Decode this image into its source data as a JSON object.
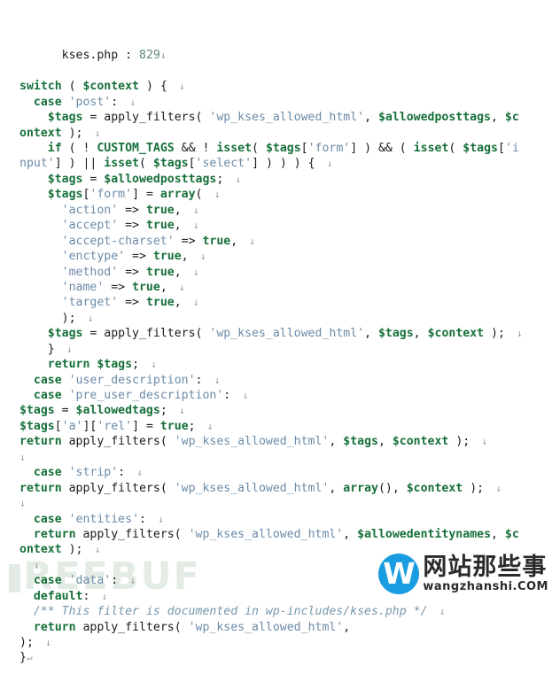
{
  "header": {
    "file_name": "kses.php",
    "separator": ":",
    "line_number": "829",
    "eol": "↓"
  },
  "watermarks": {
    "left": {
      "text": "REEBUF",
      "full_text": "FREEBUF",
      "color": "#e3ece4"
    },
    "right": {
      "logo_letter": "W",
      "logo_color": "#1a9de0",
      "title_cn": "网站那些事",
      "title_en": "wangzhanshi.COM",
      "text_color": "#2a2a2a"
    }
  },
  "colors": {
    "background": "#ffffff",
    "keyword": "#17703a",
    "variable": "#17703a",
    "string": "#6b8ba8",
    "punctuation": "#1b1b1b",
    "comment": "#7697ad",
    "eol_marker": "#9a9a9a",
    "line_number": "#5f8a74"
  },
  "eol_marker": "↓",
  "code_lines": [
    {
      "indent": 0,
      "wrapped": false,
      "tokens": [
        {
          "t": "kw",
          "v": "switch"
        },
        {
          "t": "pun",
          "v": " ( "
        },
        {
          "t": "var",
          "v": "$context"
        },
        {
          "t": "pun",
          "v": " ) {"
        },
        {
          "t": "eol",
          "v": "  ↓"
        }
      ]
    },
    {
      "indent": 1,
      "wrapped": false,
      "tokens": [
        {
          "t": "kw",
          "v": "case"
        },
        {
          "t": "pun",
          "v": " "
        },
        {
          "t": "str",
          "v": "'post'"
        },
        {
          "t": "pun",
          "v": ":"
        },
        {
          "t": "eol",
          "v": "  ↓"
        }
      ]
    },
    {
      "indent": 2,
      "wrapped": false,
      "tokens": [
        {
          "t": "var",
          "v": "$tags"
        },
        {
          "t": "pun",
          "v": " = "
        },
        {
          "t": "fn",
          "v": "apply_filters"
        },
        {
          "t": "pun",
          "v": "( "
        },
        {
          "t": "str",
          "v": "'wp_kses_allowed_html'"
        },
        {
          "t": "pun",
          "v": ", "
        },
        {
          "t": "var",
          "v": "$allowedposttags"
        },
        {
          "t": "pun",
          "v": ", "
        },
        {
          "t": "var",
          "v": "$c"
        }
      ]
    },
    {
      "indent": 0,
      "wrapped": true,
      "tokens": [
        {
          "t": "var",
          "v": "ontext"
        },
        {
          "t": "pun",
          "v": " );"
        },
        {
          "t": "eol",
          "v": "  ↓"
        }
      ]
    },
    {
      "indent": 2,
      "wrapped": false,
      "tokens": [
        {
          "t": "kw",
          "v": "if"
        },
        {
          "t": "pun",
          "v": " ( ! "
        },
        {
          "t": "var",
          "v": "CUSTOM_TAGS"
        },
        {
          "t": "pun",
          "v": " && ! "
        },
        {
          "t": "var",
          "v": "isset"
        },
        {
          "t": "pun",
          "v": "( "
        },
        {
          "t": "var",
          "v": "$tags"
        },
        {
          "t": "pun",
          "v": "["
        },
        {
          "t": "str",
          "v": "'form'"
        },
        {
          "t": "pun",
          "v": "] ) && ( "
        },
        {
          "t": "var",
          "v": "isset"
        },
        {
          "t": "pun",
          "v": "( "
        },
        {
          "t": "var",
          "v": "$tags"
        },
        {
          "t": "pun",
          "v": "["
        },
        {
          "t": "str",
          "v": "'i"
        }
      ]
    },
    {
      "indent": 0,
      "wrapped": true,
      "tokens": [
        {
          "t": "str",
          "v": "nput'"
        },
        {
          "t": "pun",
          "v": "] ) || "
        },
        {
          "t": "var",
          "v": "isset"
        },
        {
          "t": "pun",
          "v": "( "
        },
        {
          "t": "var",
          "v": "$tags"
        },
        {
          "t": "pun",
          "v": "["
        },
        {
          "t": "str",
          "v": "'select'"
        },
        {
          "t": "pun",
          "v": "] ) ) ) {"
        },
        {
          "t": "eol",
          "v": "  ↓"
        }
      ]
    },
    {
      "indent": 2,
      "wrapped": false,
      "tokens": [
        {
          "t": "var",
          "v": "$tags"
        },
        {
          "t": "pun",
          "v": " = "
        },
        {
          "t": "var",
          "v": "$allowedposttags"
        },
        {
          "t": "pun",
          "v": ";"
        },
        {
          "t": "eol",
          "v": "  ↓"
        }
      ]
    },
    {
      "indent": 2,
      "wrapped": false,
      "tokens": [
        {
          "t": "var",
          "v": "$tags"
        },
        {
          "t": "pun",
          "v": "["
        },
        {
          "t": "str",
          "v": "'form'"
        },
        {
          "t": "pun",
          "v": "] = "
        },
        {
          "t": "var",
          "v": "array"
        },
        {
          "t": "pun",
          "v": "("
        },
        {
          "t": "eol",
          "v": "  ↓"
        }
      ]
    },
    {
      "indent": 3,
      "wrapped": false,
      "tokens": [
        {
          "t": "str",
          "v": "'action'"
        },
        {
          "t": "pun",
          "v": " => "
        },
        {
          "t": "var",
          "v": "true"
        },
        {
          "t": "pun",
          "v": ","
        },
        {
          "t": "eol",
          "v": "  ↓"
        }
      ]
    },
    {
      "indent": 3,
      "wrapped": false,
      "tokens": [
        {
          "t": "str",
          "v": "'accept'"
        },
        {
          "t": "pun",
          "v": " => "
        },
        {
          "t": "var",
          "v": "true"
        },
        {
          "t": "pun",
          "v": ","
        },
        {
          "t": "eol",
          "v": "  ↓"
        }
      ]
    },
    {
      "indent": 3,
      "wrapped": false,
      "tokens": [
        {
          "t": "str",
          "v": "'accept-charset'"
        },
        {
          "t": "pun",
          "v": " => "
        },
        {
          "t": "var",
          "v": "true"
        },
        {
          "t": "pun",
          "v": ","
        },
        {
          "t": "eol",
          "v": "  ↓"
        }
      ]
    },
    {
      "indent": 3,
      "wrapped": false,
      "tokens": [
        {
          "t": "str",
          "v": "'enctype'"
        },
        {
          "t": "pun",
          "v": " => "
        },
        {
          "t": "var",
          "v": "true"
        },
        {
          "t": "pun",
          "v": ","
        },
        {
          "t": "eol",
          "v": "  ↓"
        }
      ]
    },
    {
      "indent": 3,
      "wrapped": false,
      "tokens": [
        {
          "t": "str",
          "v": "'method'"
        },
        {
          "t": "pun",
          "v": " => "
        },
        {
          "t": "var",
          "v": "true"
        },
        {
          "t": "pun",
          "v": ","
        },
        {
          "t": "eol",
          "v": "  ↓"
        }
      ]
    },
    {
      "indent": 3,
      "wrapped": false,
      "tokens": [
        {
          "t": "str",
          "v": "'name'"
        },
        {
          "t": "pun",
          "v": " => "
        },
        {
          "t": "var",
          "v": "true"
        },
        {
          "t": "pun",
          "v": ","
        },
        {
          "t": "eol",
          "v": "  ↓"
        }
      ]
    },
    {
      "indent": 3,
      "wrapped": false,
      "tokens": [
        {
          "t": "str",
          "v": "'target'"
        },
        {
          "t": "pun",
          "v": " => "
        },
        {
          "t": "var",
          "v": "true"
        },
        {
          "t": "pun",
          "v": ","
        },
        {
          "t": "eol",
          "v": "  ↓"
        }
      ]
    },
    {
      "indent": 3,
      "wrapped": false,
      "tokens": [
        {
          "t": "pun",
          "v": ");"
        },
        {
          "t": "eol",
          "v": "  ↓"
        }
      ]
    },
    {
      "indent": 2,
      "wrapped": false,
      "tokens": [
        {
          "t": "var",
          "v": "$tags"
        },
        {
          "t": "pun",
          "v": " = "
        },
        {
          "t": "fn",
          "v": "apply_filters"
        },
        {
          "t": "pun",
          "v": "( "
        },
        {
          "t": "str",
          "v": "'wp_kses_allowed_html'"
        },
        {
          "t": "pun",
          "v": ", "
        },
        {
          "t": "var",
          "v": "$tags"
        },
        {
          "t": "pun",
          "v": ", "
        },
        {
          "t": "var",
          "v": "$context"
        },
        {
          "t": "pun",
          "v": " );"
        },
        {
          "t": "eol",
          "v": "  ↓"
        }
      ]
    },
    {
      "indent": 2,
      "wrapped": false,
      "tokens": [
        {
          "t": "pun",
          "v": "}"
        },
        {
          "t": "eol",
          "v": "  ↓"
        }
      ]
    },
    {
      "indent": 2,
      "wrapped": false,
      "tokens": [
        {
          "t": "kw",
          "v": "return"
        },
        {
          "t": "pun",
          "v": " "
        },
        {
          "t": "var",
          "v": "$tags"
        },
        {
          "t": "pun",
          "v": ";"
        },
        {
          "t": "eol",
          "v": "  ↓"
        }
      ]
    },
    {
      "indent": 1,
      "wrapped": false,
      "tokens": [
        {
          "t": "kw",
          "v": "case"
        },
        {
          "t": "pun",
          "v": " "
        },
        {
          "t": "str",
          "v": "'user_description'"
        },
        {
          "t": "pun",
          "v": ":"
        },
        {
          "t": "eol",
          "v": "  ↓"
        }
      ]
    },
    {
      "indent": 1,
      "wrapped": false,
      "tokens": [
        {
          "t": "kw",
          "v": "case"
        },
        {
          "t": "pun",
          "v": " "
        },
        {
          "t": "str",
          "v": "'pre_user_description'"
        },
        {
          "t": "pun",
          "v": ":"
        },
        {
          "t": "eol",
          "v": "  ↓"
        }
      ]
    },
    {
      "indent": 0,
      "wrapped": false,
      "tokens": [
        {
          "t": "var",
          "v": "$tags"
        },
        {
          "t": "pun",
          "v": " = "
        },
        {
          "t": "var",
          "v": "$allowedtags"
        },
        {
          "t": "pun",
          "v": ";"
        },
        {
          "t": "eol",
          "v": "  ↓"
        }
      ]
    },
    {
      "indent": 0,
      "wrapped": false,
      "tokens": [
        {
          "t": "var",
          "v": "$tags"
        },
        {
          "t": "pun",
          "v": "["
        },
        {
          "t": "str",
          "v": "'a'"
        },
        {
          "t": "pun",
          "v": "]["
        },
        {
          "t": "str",
          "v": "'rel'"
        },
        {
          "t": "pun",
          "v": "] = "
        },
        {
          "t": "var",
          "v": "true"
        },
        {
          "t": "pun",
          "v": ";"
        },
        {
          "t": "eol",
          "v": "  ↓"
        }
      ]
    },
    {
      "indent": 0,
      "wrapped": false,
      "tokens": [
        {
          "t": "kw",
          "v": "return"
        },
        {
          "t": "pun",
          "v": " "
        },
        {
          "t": "fn",
          "v": "apply_filters"
        },
        {
          "t": "pun",
          "v": "( "
        },
        {
          "t": "str",
          "v": "'wp_kses_allowed_html'"
        },
        {
          "t": "pun",
          "v": ", "
        },
        {
          "t": "var",
          "v": "$tags"
        },
        {
          "t": "pun",
          "v": ", "
        },
        {
          "t": "var",
          "v": "$context"
        },
        {
          "t": "pun",
          "v": " );"
        },
        {
          "t": "eol",
          "v": "  ↓"
        }
      ]
    },
    {
      "indent": 0,
      "wrapped": false,
      "tokens": [
        {
          "t": "eol",
          "v": "↓"
        }
      ]
    },
    {
      "indent": 1,
      "wrapped": false,
      "tokens": [
        {
          "t": "kw",
          "v": "case"
        },
        {
          "t": "pun",
          "v": " "
        },
        {
          "t": "str",
          "v": "'strip'"
        },
        {
          "t": "pun",
          "v": ":"
        },
        {
          "t": "eol",
          "v": "  ↓"
        }
      ]
    },
    {
      "indent": 0,
      "wrapped": false,
      "tokens": [
        {
          "t": "kw",
          "v": "return"
        },
        {
          "t": "pun",
          "v": " "
        },
        {
          "t": "fn",
          "v": "apply_filters"
        },
        {
          "t": "pun",
          "v": "( "
        },
        {
          "t": "str",
          "v": "'wp_kses_allowed_html'"
        },
        {
          "t": "pun",
          "v": ", "
        },
        {
          "t": "var",
          "v": "array"
        },
        {
          "t": "pun",
          "v": "(), "
        },
        {
          "t": "var",
          "v": "$context"
        },
        {
          "t": "pun",
          "v": " );"
        },
        {
          "t": "eol",
          "v": "  ↓"
        }
      ]
    },
    {
      "indent": 0,
      "wrapped": false,
      "tokens": [
        {
          "t": "eol",
          "v": "↓"
        }
      ]
    },
    {
      "indent": 1,
      "wrapped": false,
      "tokens": [
        {
          "t": "kw",
          "v": "case"
        },
        {
          "t": "pun",
          "v": " "
        },
        {
          "t": "str",
          "v": "'entities'"
        },
        {
          "t": "pun",
          "v": ":"
        },
        {
          "t": "eol",
          "v": "  ↓"
        }
      ]
    },
    {
      "indent": 1,
      "wrapped": false,
      "tokens": [
        {
          "t": "kw",
          "v": "return"
        },
        {
          "t": "pun",
          "v": " "
        },
        {
          "t": "fn",
          "v": "apply_filters"
        },
        {
          "t": "pun",
          "v": "( "
        },
        {
          "t": "str",
          "v": "'wp_kses_allowed_html'"
        },
        {
          "t": "pun",
          "v": ", "
        },
        {
          "t": "var",
          "v": "$allowedentitynames"
        },
        {
          "t": "pun",
          "v": ", "
        },
        {
          "t": "var",
          "v": "$c"
        }
      ]
    },
    {
      "indent": 0,
      "wrapped": true,
      "tokens": [
        {
          "t": "var",
          "v": "ontext"
        },
        {
          "t": "pun",
          "v": " );"
        },
        {
          "t": "eol",
          "v": "  ↓"
        }
      ]
    },
    {
      "indent": 1,
      "wrapped": false,
      "tokens": [
        {
          "t": "eol",
          "v": "↓"
        }
      ]
    },
    {
      "indent": 1,
      "wrapped": false,
      "tokens": [
        {
          "t": "kw",
          "v": "case"
        },
        {
          "t": "pun",
          "v": " "
        },
        {
          "t": "str",
          "v": "'data'"
        },
        {
          "t": "pun",
          "v": ":"
        },
        {
          "t": "eol",
          "v": "  ↓"
        }
      ]
    },
    {
      "indent": 1,
      "wrapped": false,
      "tokens": [
        {
          "t": "kw",
          "v": "default"
        },
        {
          "t": "pun",
          "v": ":"
        },
        {
          "t": "eol",
          "v": "  ↓"
        }
      ]
    },
    {
      "indent": 1,
      "wrapped": false,
      "tokens": [
        {
          "t": "cmt",
          "v": "/** This filter is documented in wp-includes/kses.php */"
        },
        {
          "t": "eol",
          "v": "  ↓"
        }
      ]
    },
    {
      "indent": 1,
      "wrapped": false,
      "tokens": [
        {
          "t": "kw",
          "v": "return"
        },
        {
          "t": "pun",
          "v": " "
        },
        {
          "t": "fn",
          "v": "apply_filters"
        },
        {
          "t": "pun",
          "v": "( "
        },
        {
          "t": "str",
          "v": "'wp_kses_allowed_html'"
        },
        {
          "t": "pun",
          "v": ","
        }
      ]
    },
    {
      "indent": 0,
      "wrapped": true,
      "tokens": [
        {
          "t": "pun",
          "v": ");"
        },
        {
          "t": "eol",
          "v": "  ↓"
        }
      ]
    },
    {
      "indent": 0,
      "wrapped": true,
      "tokens": [
        {
          "t": "pun",
          "v": "}"
        },
        {
          "t": "eol",
          "v": "↵"
        }
      ]
    }
  ]
}
